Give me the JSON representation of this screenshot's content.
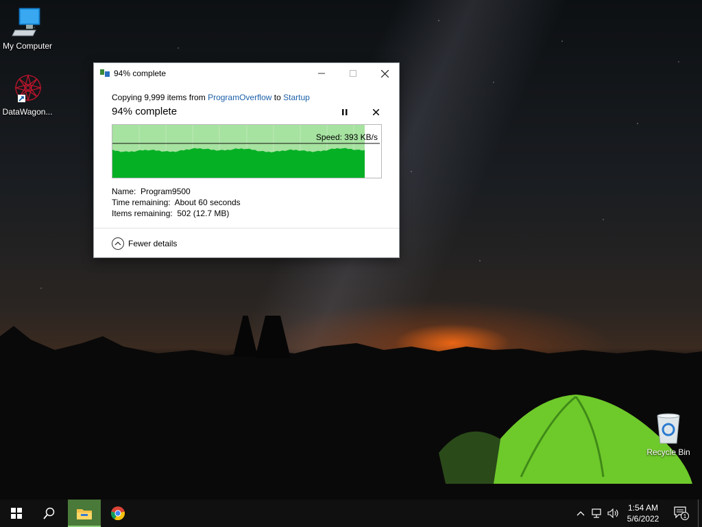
{
  "desktop": {
    "icons": [
      {
        "label": "My Computer",
        "icon": "computer-icon"
      },
      {
        "label": "DataWagon...",
        "icon": "datawagon-icon"
      },
      {
        "label": "Recycle Bin",
        "icon": "recycle-bin-icon"
      }
    ]
  },
  "dialog": {
    "title": "94% complete",
    "copy_prefix": "Copying 9,999 items from",
    "source": "ProgramOverflow",
    "to_word": "to",
    "destination": "Startup",
    "status": "94% complete",
    "speed": "Speed: 393 KB/s",
    "progress_fraction": 0.94,
    "name_label": "Name:",
    "name_value": "Program9500",
    "time_label": "Time remaining:",
    "time_value": "About 60 seconds",
    "items_label": "Items remaining:",
    "items_value": "502 (12.7 MB)",
    "fewer_details": "Fewer details",
    "colors": {
      "progress_bg": "#a6e2a0",
      "progress_fill": "#06b025",
      "link": "#1a5fa8"
    }
  },
  "taskbar": {
    "time": "1:54 AM",
    "date": "5/6/2022",
    "notification_count": "1",
    "pinned": [
      "start-icon",
      "search-icon",
      "file-explorer-icon",
      "chrome-icon"
    ]
  }
}
